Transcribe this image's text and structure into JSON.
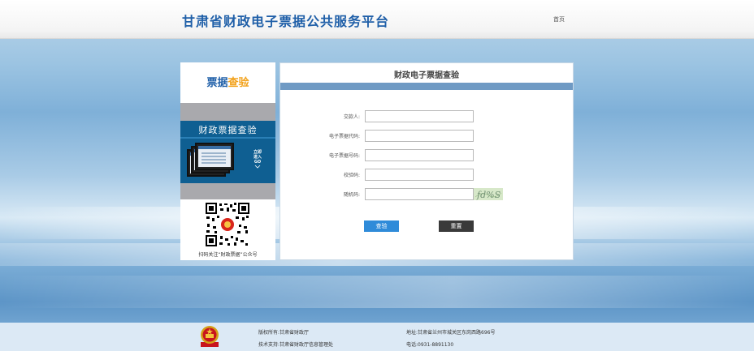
{
  "header": {
    "site_title": "甘肃省财政电子票据公共服务平台",
    "home_link": "首页"
  },
  "sidebar": {
    "title_part1": "票据",
    "title_part2": "查验",
    "banner_text": "财政票据查验",
    "go_line1": "立即",
    "go_line2": "进入",
    "go_line3": "GO",
    "qr_caption": "扫码关注“财政票据”公众号"
  },
  "panel": {
    "title": "财政电子票据查验",
    "fields": [
      {
        "label": "交款人:",
        "value": "",
        "placeholder": ""
      },
      {
        "label": "电子票据代码:",
        "value": "",
        "placeholder": ""
      },
      {
        "label": "电子票据号码:",
        "value": "",
        "placeholder": ""
      },
      {
        "label": "校验码:",
        "value": "",
        "placeholder": ""
      },
      {
        "label": "随机码:",
        "value": "",
        "placeholder": ""
      }
    ],
    "captcha_text": "fd%S",
    "query_button": "查验",
    "reset_button": "重置"
  },
  "footer": {
    "copyright": "版权所有:甘肃省财政厅",
    "tech_support": "技术支持:甘肃省财政厅信息管理处",
    "address": "地址:甘肃省兰州市城关区东岗西路696号",
    "phone": "电话:0931-8891130"
  },
  "colors": {
    "brand_blue": "#1f5fa8",
    "accent_orange": "#f2a11a",
    "query_button": "#2f8bd9",
    "reset_button": "#3a3a3a",
    "banner_blue": "#0f5f92"
  }
}
